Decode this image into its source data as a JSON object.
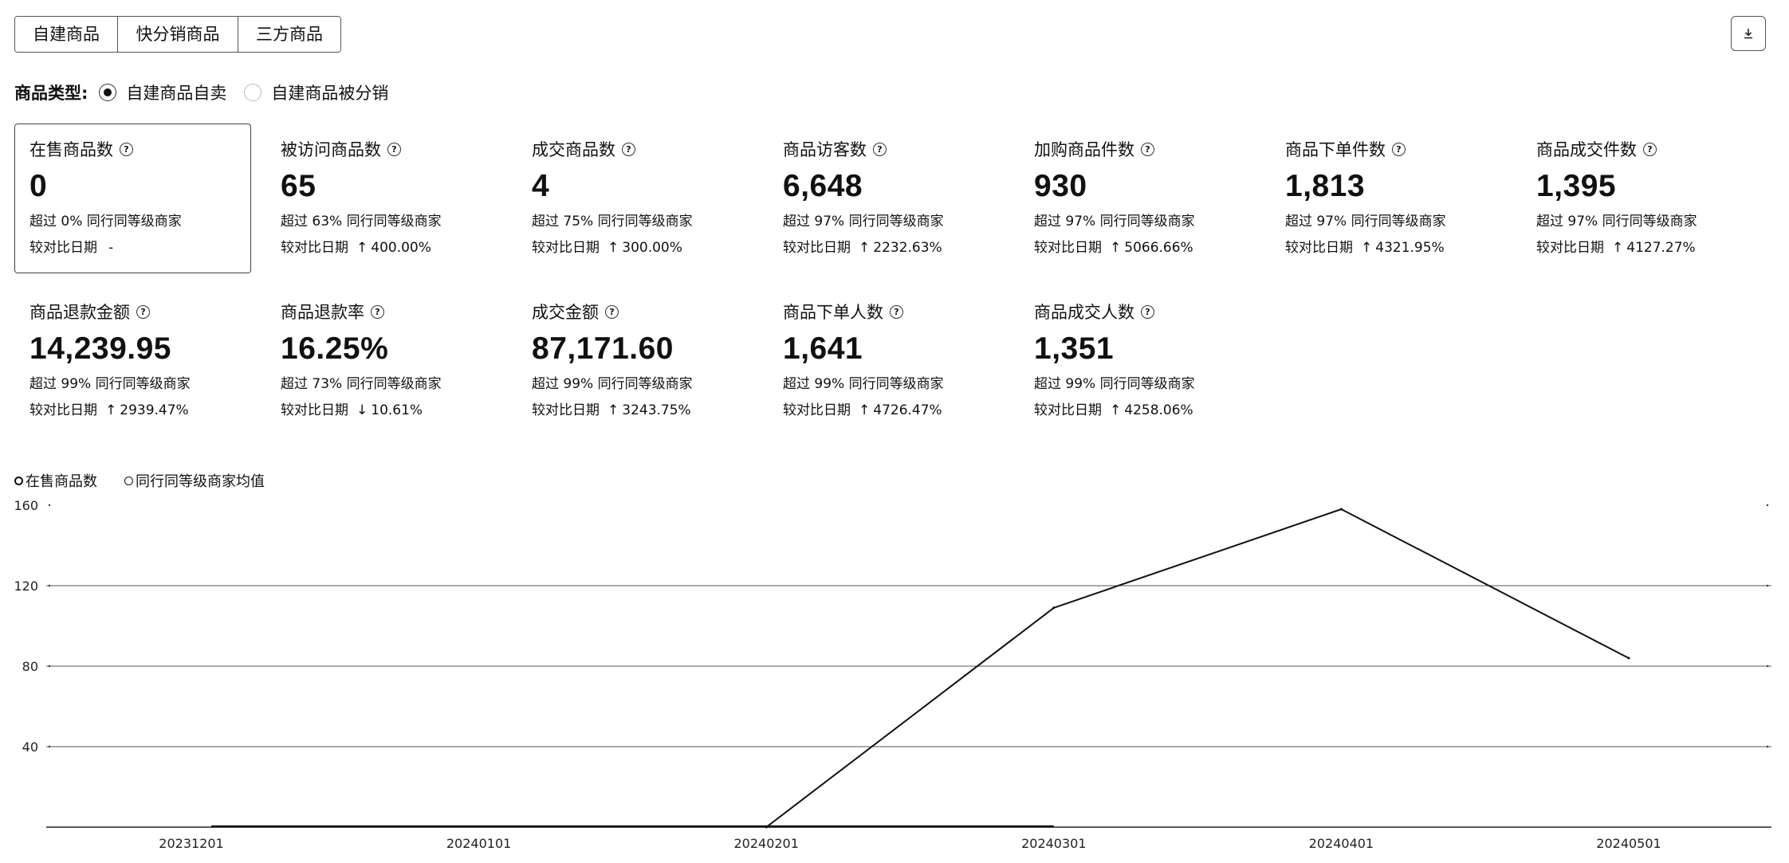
{
  "tabs": [
    {
      "label": "自建商品",
      "active": true
    },
    {
      "label": "快分销商品",
      "active": false
    },
    {
      "label": "三方商品",
      "active": false
    }
  ],
  "download": {
    "icon": "download-icon"
  },
  "product_type": {
    "label": "商品类型:",
    "options": [
      {
        "label": "自建商品自卖",
        "selected": true
      },
      {
        "label": "自建商品被分销",
        "selected": false
      }
    ]
  },
  "metrics": [
    {
      "title": "在售商品数",
      "value": "0",
      "percentile": "超过 0% 同行同等级商家",
      "compare_label": "较对比日期",
      "compare_arrow": "",
      "compare_value": "-",
      "selected": true
    },
    {
      "title": "被访问商品数",
      "value": "65",
      "percentile": "超过 63% 同行同等级商家",
      "compare_label": "较对比日期",
      "compare_arrow": "↑",
      "compare_value": "400.00%"
    },
    {
      "title": "成交商品数",
      "value": "4",
      "percentile": "超过 75% 同行同等级商家",
      "compare_label": "较对比日期",
      "compare_arrow": "↑",
      "compare_value": "300.00%"
    },
    {
      "title": "商品访客数",
      "value": "6,648",
      "percentile": "超过 97% 同行同等级商家",
      "compare_label": "较对比日期",
      "compare_arrow": "↑",
      "compare_value": "2232.63%"
    },
    {
      "title": "加购商品件数",
      "value": "930",
      "percentile": "超过 97% 同行同等级商家",
      "compare_label": "较对比日期",
      "compare_arrow": "↑",
      "compare_value": "5066.66%"
    },
    {
      "title": "商品下单件数",
      "value": "1,813",
      "percentile": "超过 97% 同行同等级商家",
      "compare_label": "较对比日期",
      "compare_arrow": "↑",
      "compare_value": "4321.95%"
    },
    {
      "title": "商品成交件数",
      "value": "1,395",
      "percentile": "超过 97% 同行同等级商家",
      "compare_label": "较对比日期",
      "compare_arrow": "↑",
      "compare_value": "4127.27%"
    },
    {
      "title": "商品退款金额",
      "value": "14,239.95",
      "percentile": "超过 99% 同行同等级商家",
      "compare_label": "较对比日期",
      "compare_arrow": "↑",
      "compare_value": "2939.47%"
    },
    {
      "title": "商品退款率",
      "value": "16.25%",
      "percentile": "超过 73% 同行同等级商家",
      "compare_label": "较对比日期",
      "compare_arrow": "↓",
      "compare_value": "10.61%"
    },
    {
      "title": "成交金额",
      "value": "87,171.60",
      "percentile": "超过 99% 同行同等级商家",
      "compare_label": "较对比日期",
      "compare_arrow": "↑",
      "compare_value": "3243.75%"
    },
    {
      "title": "商品下单人数",
      "value": "1,641",
      "percentile": "超过 99% 同行同等级商家",
      "compare_label": "较对比日期",
      "compare_arrow": "↑",
      "compare_value": "4726.47%"
    },
    {
      "title": "商品成交人数",
      "value": "1,351",
      "percentile": "超过 99% 同行同等级商家",
      "compare_label": "较对比日期",
      "compare_arrow": "↑",
      "compare_value": "4258.06%"
    }
  ],
  "legend": [
    {
      "label": "在售商品数"
    },
    {
      "label": "同行同等级商家均值"
    }
  ],
  "chart_data": {
    "type": "line",
    "categories": [
      "20231201",
      "20240101",
      "20240201",
      "20240301",
      "20240401",
      "20240501"
    ],
    "series": [
      {
        "name": "在售商品数",
        "values": [
          0,
          0,
          0,
          0,
          0,
          0
        ]
      },
      {
        "name": "同行同等级商家均值",
        "values": [
          0,
          0,
          0,
          109,
          158,
          84
        ]
      }
    ],
    "yticks": [
      40,
      80,
      120,
      160
    ],
    "ylim": [
      0,
      160
    ],
    "grid": true,
    "title": "",
    "xlabel": "",
    "ylabel": ""
  }
}
